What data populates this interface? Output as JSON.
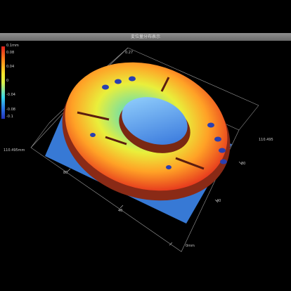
{
  "window": {
    "title": "変位量分布表示"
  },
  "legend": {
    "ticks": [
      "0.1mm",
      "0.08",
      "0.04",
      "0",
      "-0.04",
      "-0.08",
      "-0.1"
    ],
    "colors": [
      "#e0201c",
      "#ff8c1a",
      "#f5e52a",
      "#d9f04a",
      "#3ad8e8",
      "#2a7ae6",
      "#2431b8"
    ]
  },
  "axes": {
    "z_max": "0.27",
    "x_left": "110.495mm",
    "x_right": "110.495",
    "x_ticks": [
      "80",
      "40"
    ],
    "y_ticks": [
      "80",
      "40"
    ],
    "origin": "0mm"
  },
  "colors": {
    "background": "#000000",
    "base_plate": "#3a7fe0"
  }
}
